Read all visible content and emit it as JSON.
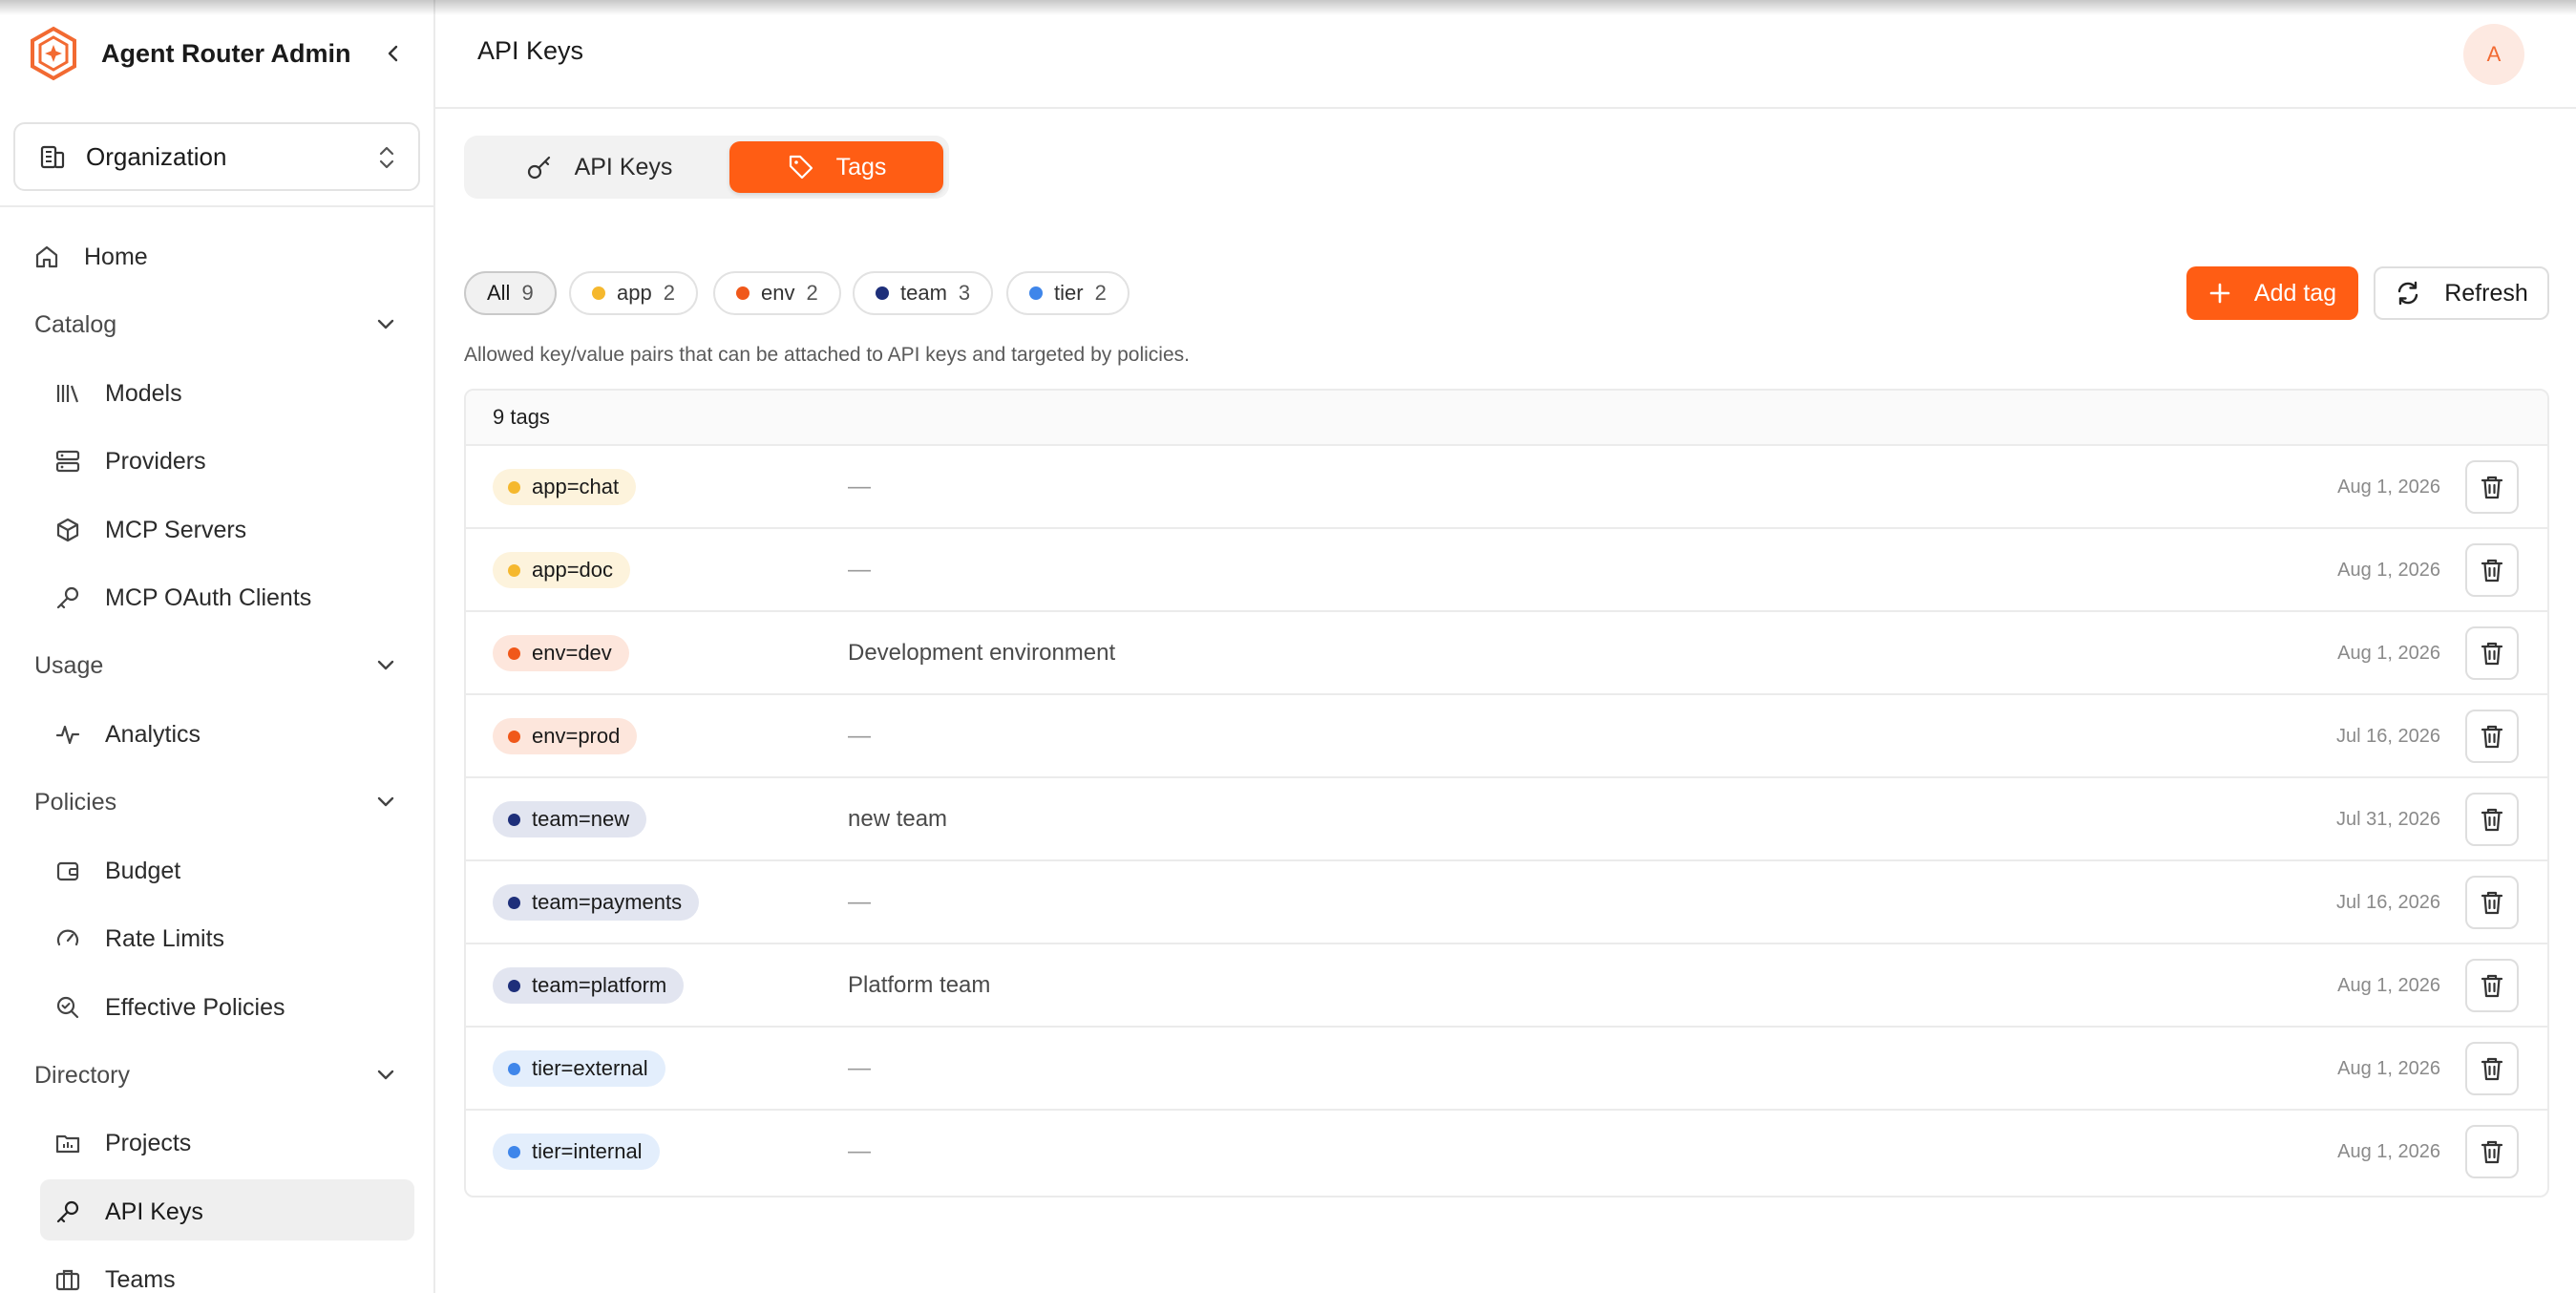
{
  "brand": {
    "title": "Agent Router Admin"
  },
  "org": {
    "label": "Organization"
  },
  "nav": {
    "home": "Home",
    "catalog": "Catalog",
    "models": "Models",
    "providers": "Providers",
    "mcp_servers": "MCP Servers",
    "mcp_oauth": "MCP OAuth Clients",
    "usage": "Usage",
    "analytics": "Analytics",
    "policies": "Policies",
    "budget": "Budget",
    "rate_limits": "Rate Limits",
    "effective_policies": "Effective Policies",
    "directory": "Directory",
    "projects": "Projects",
    "api_keys": "API Keys",
    "teams": "Teams"
  },
  "header": {
    "title": "API Keys",
    "avatar_initial": "A"
  },
  "tabs": {
    "api_keys": "API Keys",
    "tags": "Tags"
  },
  "filters": [
    {
      "label": "All",
      "count": "9",
      "color": ""
    },
    {
      "label": "app",
      "count": "2",
      "color": "#f5b82e"
    },
    {
      "label": "env",
      "count": "2",
      "color": "#f0581a"
    },
    {
      "label": "team",
      "count": "3",
      "color": "#1e2f7a"
    },
    {
      "label": "tier",
      "count": "2",
      "color": "#3f86ea"
    }
  ],
  "actions": {
    "add": "Add tag",
    "refresh": "Refresh"
  },
  "description": "Allowed key/value pairs that can be attached to API keys and targeted by policies.",
  "table": {
    "count_label": "9 tags",
    "rows": [
      {
        "tag": "app=chat",
        "desc": "—",
        "date": "Aug 1, 2026"
      },
      {
        "tag": "app=doc",
        "desc": "—",
        "date": "Aug 1, 2026"
      },
      {
        "tag": "env=dev",
        "desc": "Development environment",
        "date": "Aug 1, 2026"
      },
      {
        "tag": "env=prod",
        "desc": "—",
        "date": "Jul 16, 2026"
      },
      {
        "tag": "team=new",
        "desc": "new team",
        "date": "Jul 31, 2026"
      },
      {
        "tag": "team=payments",
        "desc": "—",
        "date": "Jul 16, 2026"
      },
      {
        "tag": "team=platform",
        "desc": "Platform team",
        "date": "Aug 1, 2026"
      },
      {
        "tag": "tier=external",
        "desc": "—",
        "date": "Aug 1, 2026"
      },
      {
        "tag": "tier=internal",
        "desc": "—",
        "date": "Aug 1, 2026"
      }
    ]
  },
  "colors": {
    "accent": "#ff5d14",
    "app_dot": "#f5b82e",
    "app_bg": "#fdf3dc",
    "env_dot": "#f0581a",
    "env_bg": "#fde6dc",
    "team_dot": "#1e2f7a",
    "team_bg": "#e2e5f0",
    "tier_dot": "#3f86ea",
    "tier_bg": "#e3eefc"
  }
}
